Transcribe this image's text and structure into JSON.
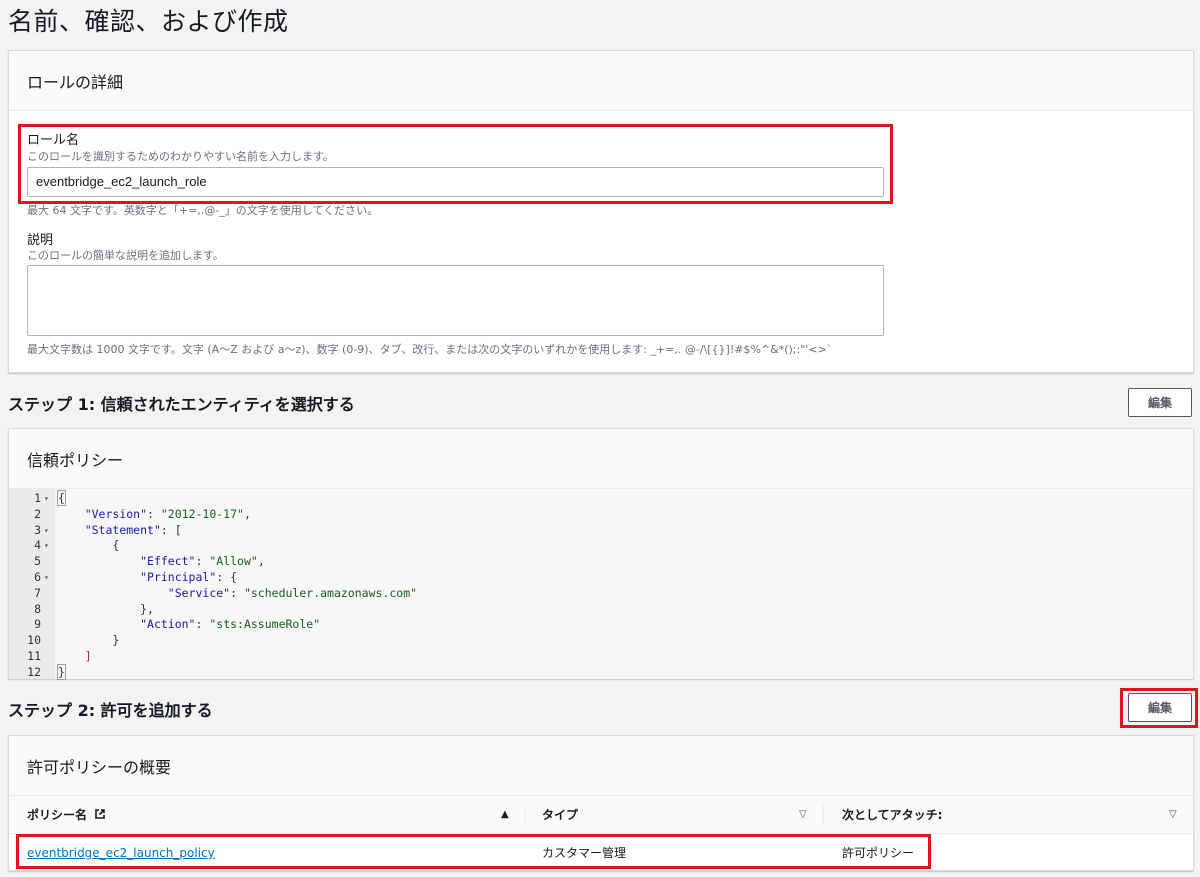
{
  "page_title": "名前、確認、および作成",
  "role_details": {
    "header": "ロールの詳細",
    "role_name_label": "ロール名",
    "role_name_desc": "このロールを識別するためのわかりやすい名前を入力します。",
    "role_name_value": "eventbridge_ec2_launch_role",
    "role_name_constraint": "最大 64 文字です。英数字と「+=,.@-_」の文字を使用してください。",
    "description_label": "説明",
    "description_desc": "このロールの簡単な説明を追加します。",
    "description_value": "",
    "description_constraint": "最大文字数は 1000 文字です。文字 (A～Z および a～z)、数字 (0-9)、タブ、改行、または次の文字のいずれかを使用します: _+=,. @-/\\[{}]!#$%^&*();:\"'<>`"
  },
  "step1": {
    "title": "ステップ 1: 信頼されたエンティティを選択する",
    "edit_label": "編集",
    "trust_policy_header": "信頼ポリシー",
    "code_lines": [
      {
        "n": "1",
        "fold": true
      },
      {
        "n": "2",
        "fold": false
      },
      {
        "n": "3",
        "fold": true
      },
      {
        "n": "4",
        "fold": true
      },
      {
        "n": "5",
        "fold": false
      },
      {
        "n": "6",
        "fold": true
      },
      {
        "n": "7",
        "fold": false
      },
      {
        "n": "8",
        "fold": false
      },
      {
        "n": "9",
        "fold": false
      },
      {
        "n": "10",
        "fold": false
      },
      {
        "n": "11",
        "fold": false
      },
      {
        "n": "12",
        "fold": false
      }
    ],
    "code": {
      "l1": "{",
      "l2_key": "\"Version\"",
      "l2_val": "\"2012-10-17\"",
      "l3_key": "\"Statement\"",
      "l3_rest": ": [",
      "l4": "{",
      "l5_key": "\"Effect\"",
      "l5_val": "\"Allow\"",
      "l6_key": "\"Principal\"",
      "l6_rest": ": {",
      "l7_key": "\"Service\"",
      "l7_val": "\"scheduler.amazonaws.com\"",
      "l8": "},",
      "l9_key": "\"Action\"",
      "l9_val": "\"sts:AssumeRole\"",
      "l10": "}",
      "l11": "]",
      "l12": "}"
    }
  },
  "step2": {
    "title": "ステップ 2: 許可を追加する",
    "edit_label": "編集",
    "summary_header": "許可ポリシーの概要",
    "columns": [
      "ポリシー名",
      "タイプ",
      "次としてアタッチ:"
    ],
    "rows": [
      {
        "policy_name": "eventbridge_ec2_launch_policy",
        "type": "カスタマー管理",
        "attached_as": "許可ポリシー"
      }
    ]
  },
  "colors": {
    "highlight": "#e0141e",
    "link": "#0073bb"
  }
}
